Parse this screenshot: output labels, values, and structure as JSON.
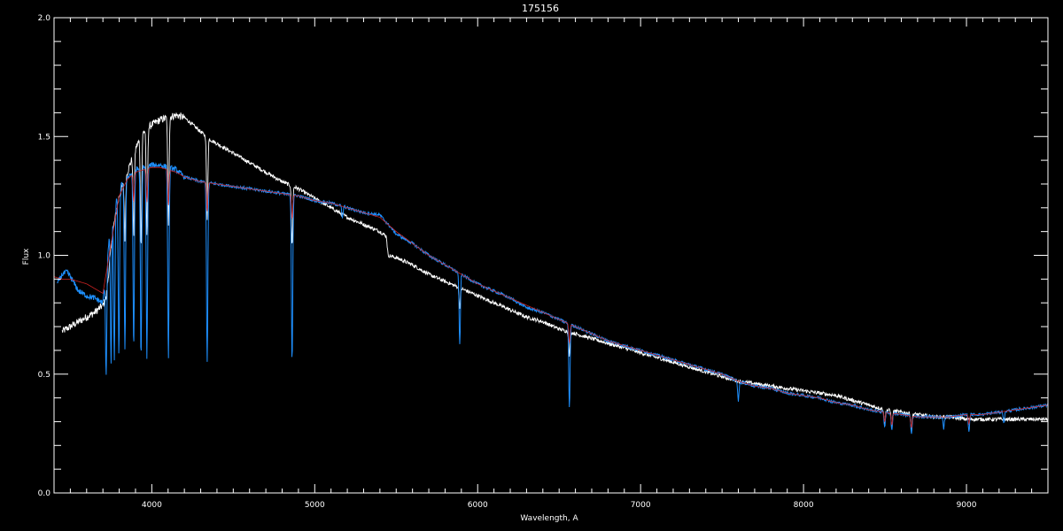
{
  "chart_data": {
    "type": "line",
    "title": "175156",
    "xlabel": "Wavelength, A",
    "ylabel": "Flux",
    "xlim": [
      3400,
      9500
    ],
    "ylim": [
      0.0,
      2.0
    ],
    "x_ticks": [
      4000,
      5000,
      6000,
      7000,
      8000,
      9000
    ],
    "x_tick_labels": [
      "4000",
      "5000",
      "6000",
      "7000",
      "8000",
      "9000"
    ],
    "y_ticks": [
      0.0,
      0.5,
      1.0,
      1.5,
      2.0
    ],
    "y_tick_labels": [
      "0.0",
      "0.5",
      "1.0",
      "1.5",
      "2.0"
    ],
    "grid": false,
    "background": "#000000",
    "axis_color": "#ffffff",
    "series": [
      {
        "color": "#ffffff",
        "x": [
          3450,
          3500,
          3550,
          3600,
          3650,
          3700,
          3720,
          3760,
          3800,
          3850,
          3900,
          3950,
          4000,
          4050,
          4100,
          4150,
          4200,
          4250,
          4300,
          4350,
          4400,
          4450,
          4500,
          4600,
          4700,
          4800,
          4900,
          5000,
          5100,
          5200,
          5300,
          5400,
          5440,
          5450,
          5500,
          5600,
          5700,
          5800,
          5900,
          6000,
          6100,
          6200,
          6300,
          6400,
          6500,
          6600,
          6700,
          6800,
          6900,
          7000,
          7100,
          7200,
          7300,
          7400,
          7500,
          7600,
          7700,
          7800,
          7900,
          8000,
          8100,
          8200,
          8300,
          8400,
          8500,
          8600,
          8700,
          8800,
          8900,
          9000,
          9100,
          9200,
          9300,
          9400,
          9500
        ],
        "values": [
          0.68,
          0.7,
          0.72,
          0.74,
          0.76,
          0.79,
          0.82,
          1.1,
          1.25,
          1.35,
          1.45,
          1.52,
          1.55,
          1.57,
          1.58,
          1.59,
          1.58,
          1.55,
          1.52,
          1.49,
          1.47,
          1.45,
          1.43,
          1.39,
          1.35,
          1.31,
          1.28,
          1.24,
          1.2,
          1.16,
          1.13,
          1.1,
          1.08,
          1.0,
          0.99,
          0.96,
          0.92,
          0.89,
          0.86,
          0.83,
          0.8,
          0.77,
          0.74,
          0.72,
          0.69,
          0.67,
          0.65,
          0.63,
          0.61,
          0.59,
          0.57,
          0.55,
          0.53,
          0.51,
          0.49,
          0.47,
          0.46,
          0.45,
          0.44,
          0.43,
          0.42,
          0.41,
          0.39,
          0.37,
          0.35,
          0.34,
          0.33,
          0.32,
          0.32,
          0.31,
          0.31,
          0.31,
          0.31,
          0.31,
          0.31
        ],
        "absorption_lines": [
          {
            "x": 3835,
            "depth": 0.25
          },
          {
            "x": 3889,
            "depth": 0.35
          },
          {
            "x": 3934,
            "depth": 0.45
          },
          {
            "x": 3970,
            "depth": 0.45
          },
          {
            "x": 4102,
            "depth": 0.45
          },
          {
            "x": 4340,
            "depth": 0.35
          },
          {
            "x": 4861,
            "depth": 0.25
          },
          {
            "x": 5890,
            "depth": 0.08
          },
          {
            "x": 6563,
            "depth": 0.1
          },
          {
            "x": 8498,
            "depth": 0.06
          },
          {
            "x": 8542,
            "depth": 0.07
          },
          {
            "x": 8662,
            "depth": 0.07
          }
        ]
      },
      {
        "color": "#1e90ff",
        "x": [
          3420,
          3450,
          3480,
          3500,
          3550,
          3600,
          3650,
          3700,
          3720,
          3750,
          3800,
          3850,
          3900,
          3950,
          4000,
          4050,
          4100,
          4150,
          4200,
          4300,
          4400,
          4500,
          4600,
          4700,
          4800,
          4900,
          5000,
          5100,
          5200,
          5300,
          5400,
          5500,
          5600,
          5700,
          5800,
          5900,
          6000,
          6100,
          6200,
          6300,
          6400,
          6500,
          6600,
          6700,
          6800,
          6900,
          7000,
          7100,
          7200,
          7300,
          7400,
          7500,
          7600,
          7700,
          7800,
          7900,
          8000,
          8100,
          8200,
          8300,
          8400,
          8500,
          8600,
          8700,
          8800,
          8900,
          9000,
          9100,
          9200,
          9300,
          9400,
          9500
        ],
        "values": [
          0.88,
          0.92,
          0.93,
          0.91,
          0.85,
          0.83,
          0.82,
          0.8,
          0.95,
          1.15,
          1.28,
          1.33,
          1.36,
          1.37,
          1.38,
          1.38,
          1.37,
          1.36,
          1.33,
          1.31,
          1.3,
          1.29,
          1.28,
          1.27,
          1.26,
          1.25,
          1.23,
          1.22,
          1.2,
          1.18,
          1.17,
          1.09,
          1.05,
          1.0,
          0.96,
          0.92,
          0.88,
          0.85,
          0.82,
          0.78,
          0.76,
          0.73,
          0.7,
          0.67,
          0.64,
          0.62,
          0.6,
          0.58,
          0.56,
          0.54,
          0.52,
          0.5,
          0.47,
          0.45,
          0.44,
          0.42,
          0.41,
          0.4,
          0.38,
          0.37,
          0.35,
          0.34,
          0.33,
          0.32,
          0.32,
          0.32,
          0.33,
          0.33,
          0.34,
          0.35,
          0.36,
          0.37
        ],
        "absorption_lines": [
          {
            "x": 3720,
            "depth": 0.45
          },
          {
            "x": 3750,
            "depth": 0.6
          },
          {
            "x": 3770,
            "depth": 0.65
          },
          {
            "x": 3798,
            "depth": 0.7
          },
          {
            "x": 3835,
            "depth": 0.72
          },
          {
            "x": 3889,
            "depth": 0.75
          },
          {
            "x": 3934,
            "depth": 0.8
          },
          {
            "x": 3970,
            "depth": 0.8
          },
          {
            "x": 4102,
            "depth": 0.8
          },
          {
            "x": 4340,
            "depth": 0.75
          },
          {
            "x": 4861,
            "depth": 0.7
          },
          {
            "x": 5170,
            "depth": 0.05
          },
          {
            "x": 5890,
            "depth": 0.3
          },
          {
            "x": 6563,
            "depth": 0.35
          },
          {
            "x": 7600,
            "depth": 0.08
          },
          {
            "x": 8498,
            "depth": 0.06
          },
          {
            "x": 8542,
            "depth": 0.07
          },
          {
            "x": 8662,
            "depth": 0.07
          },
          {
            "x": 8860,
            "depth": 0.05
          },
          {
            "x": 9015,
            "depth": 0.07
          },
          {
            "x": 9230,
            "depth": 0.05
          }
        ]
      },
      {
        "color": "#cc2222",
        "x": [
          3400,
          3450,
          3500,
          3550,
          3600,
          3650,
          3700,
          3750,
          3800,
          3850,
          3900,
          3950,
          4000,
          4050,
          4100,
          4150,
          4200,
          4300,
          4400,
          4500,
          4600,
          4700,
          4800,
          4900,
          5000,
          5100,
          5200,
          5300,
          5400,
          5500,
          5600,
          5700,
          5800,
          5900,
          6000,
          6100,
          6200,
          6300,
          6400,
          6500,
          6600,
          6700,
          6800,
          6900,
          7000,
          7100,
          7200,
          7300,
          7400,
          7500,
          7600,
          7700,
          7800,
          7900,
          8000,
          8100,
          8200,
          8300,
          8400,
          8500,
          8600,
          8700,
          8800,
          8900,
          9000,
          9100,
          9200,
          9300,
          9400,
          9500
        ],
        "values": [
          0.91,
          0.9,
          0.9,
          0.89,
          0.88,
          0.86,
          0.84,
          1.05,
          1.25,
          1.32,
          1.35,
          1.36,
          1.37,
          1.37,
          1.36,
          1.35,
          1.33,
          1.31,
          1.3,
          1.29,
          1.28,
          1.27,
          1.26,
          1.25,
          1.23,
          1.22,
          1.2,
          1.18,
          1.16,
          1.1,
          1.05,
          1.0,
          0.96,
          0.92,
          0.88,
          0.85,
          0.82,
          0.79,
          0.76,
          0.73,
          0.7,
          0.67,
          0.64,
          0.62,
          0.6,
          0.58,
          0.56,
          0.54,
          0.52,
          0.5,
          0.47,
          0.45,
          0.44,
          0.42,
          0.41,
          0.4,
          0.38,
          0.37,
          0.35,
          0.34,
          0.33,
          0.32,
          0.32,
          0.32,
          0.33,
          0.33,
          0.34,
          0.35,
          0.36,
          0.37
        ],
        "absorption_lines": [
          {
            "x": 3889,
            "depth": 0.12
          },
          {
            "x": 3970,
            "depth": 0.14
          },
          {
            "x": 4102,
            "depth": 0.15
          },
          {
            "x": 4340,
            "depth": 0.12
          },
          {
            "x": 4861,
            "depth": 0.1
          },
          {
            "x": 6563,
            "depth": 0.08
          },
          {
            "x": 8498,
            "depth": 0.04
          },
          {
            "x": 8542,
            "depth": 0.05
          },
          {
            "x": 8662,
            "depth": 0.05
          },
          {
            "x": 9015,
            "depth": 0.04
          }
        ]
      }
    ]
  }
}
